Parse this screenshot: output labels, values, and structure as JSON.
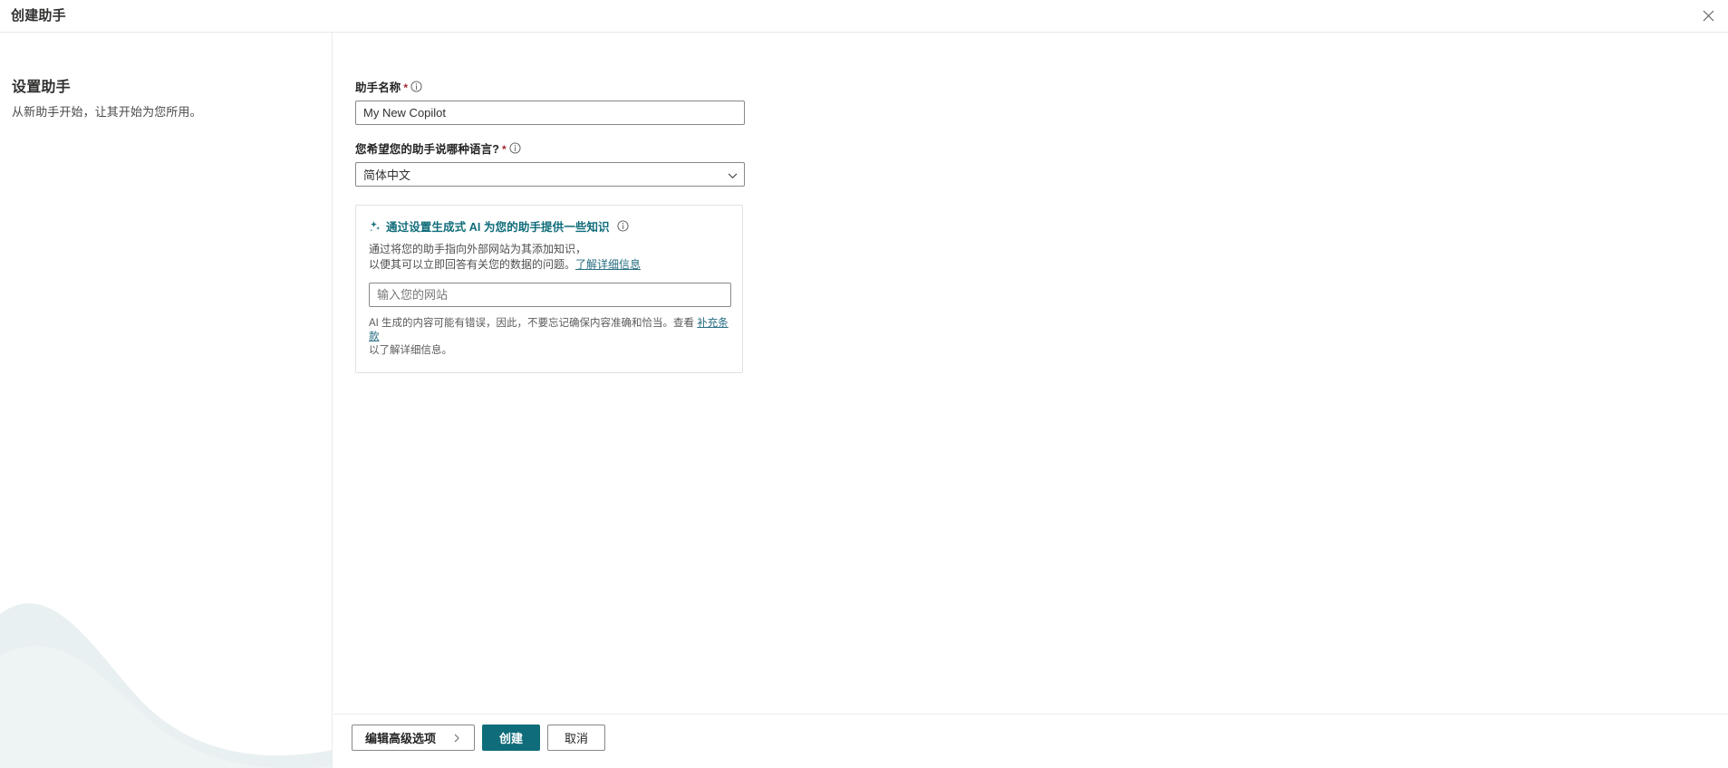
{
  "window": {
    "title": "创建助手",
    "close_icon": "close-icon"
  },
  "left_panel": {
    "heading": "设置助手",
    "subtitle": "从新助手开始，让其开始为您所用。"
  },
  "form": {
    "name_field": {
      "label": "助手名称",
      "required_marker": "*",
      "info_icon": "info-icon",
      "value": "My New Copilot",
      "placeholder": "My New Copilot"
    },
    "language_field": {
      "label": "您希望您的助手说哪种语言?",
      "required_marker": "*",
      "info_icon": "info-icon",
      "selected": "简体中文",
      "chevron_icon": "chevron-down-icon"
    },
    "ai_card": {
      "sparkle_icon": "sparkle-icon",
      "heading": "通过设置生成式 AI 为您的助手提供一些知识",
      "info_icon": "info-icon",
      "desc_line1": "通过将您的助手指向外部网站为其添加知识，",
      "desc_line2": "以便其可以立即回答有关您的数据的问题。",
      "desc_link": "了解详细信息",
      "website_placeholder": "输入您的网站",
      "website_value": "",
      "disclaimer_pre": "AI 生成的内容可能有错误，因此，不要忘记确保内容准确和恰当。查看 ",
      "disclaimer_link": "补充条款",
      "disclaimer_post": "以了解详细信息。"
    }
  },
  "footer": {
    "advanced_label": "编辑高级选项",
    "advanced_chevron": "chevron-right-icon",
    "create_label": "创建",
    "cancel_label": "取消"
  },
  "colors": {
    "accent": "#0f6c7a",
    "link": "#286d82",
    "required": "#a4262c",
    "border": "#8a8886",
    "wave": "#e8eff0"
  }
}
